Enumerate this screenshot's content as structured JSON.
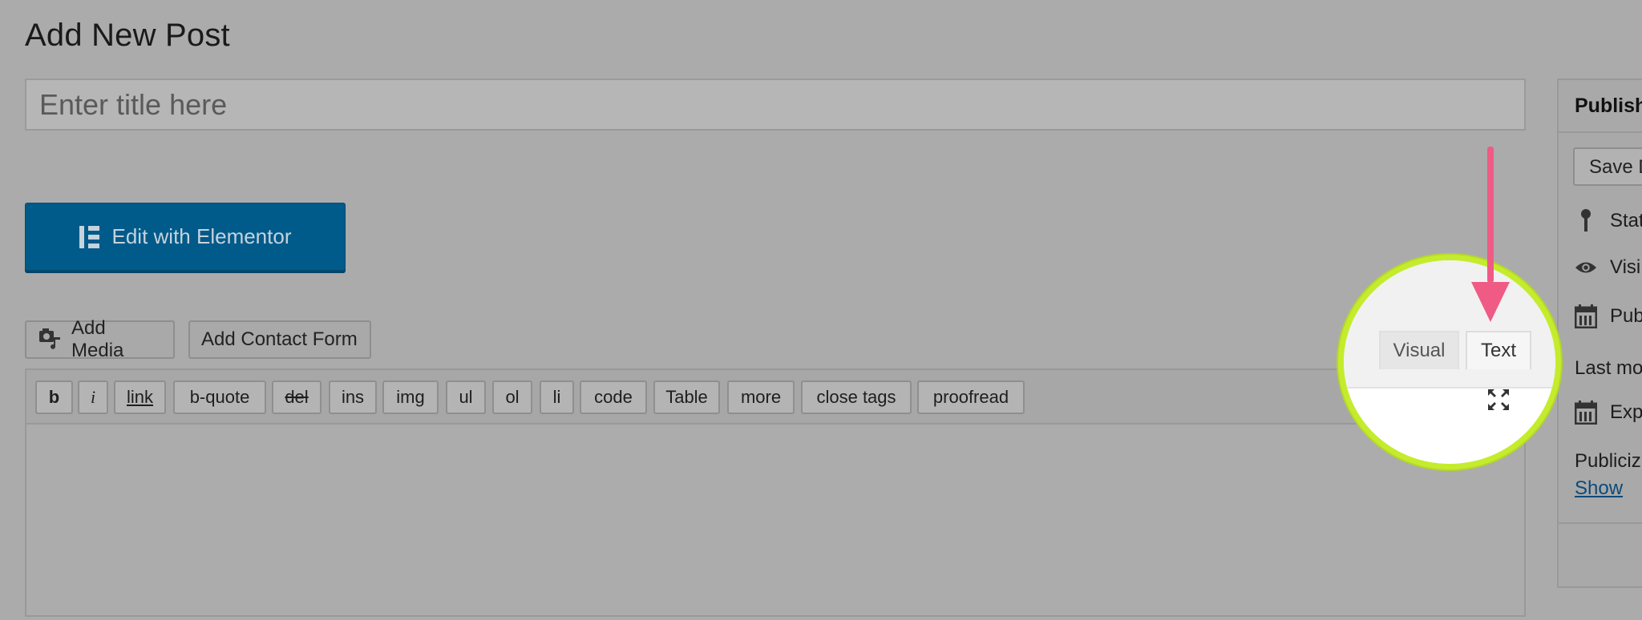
{
  "page": {
    "title": "Add New Post"
  },
  "title_field": {
    "placeholder": "Enter title here",
    "value": ""
  },
  "elementor": {
    "label": "Edit with Elementor",
    "icon": "elementor-logo-icon"
  },
  "media_buttons": {
    "add_media": "Add Media",
    "add_media_icon": "media-icon",
    "add_contact_form": "Add Contact Form"
  },
  "editor": {
    "tabs": [
      {
        "label": "Visual",
        "active": false
      },
      {
        "label": "Text",
        "active": true
      }
    ],
    "fullscreen_icon": "fullscreen-icon",
    "quicktags": [
      "b",
      "i",
      "link",
      "b-quote",
      "del",
      "ins",
      "img",
      "ul",
      "ol",
      "li",
      "code",
      "Table",
      "more",
      "close tags",
      "proofread"
    ]
  },
  "publish_box": {
    "header": "Publish",
    "save_draft": "Save D",
    "status_label": "Stat",
    "visibility_label": "Visi",
    "publish_label": "Pub",
    "last_modified": "Last mo",
    "expire_label": "Exp",
    "publicize_label": "Publiciz",
    "show_link": "Show",
    "icons": [
      "pin-icon",
      "eye-icon",
      "calendar-icon",
      "calendar-icon"
    ]
  },
  "annotation": {
    "highlight_color": "#c4ec2d",
    "arrow_color": "#ef5b85"
  }
}
